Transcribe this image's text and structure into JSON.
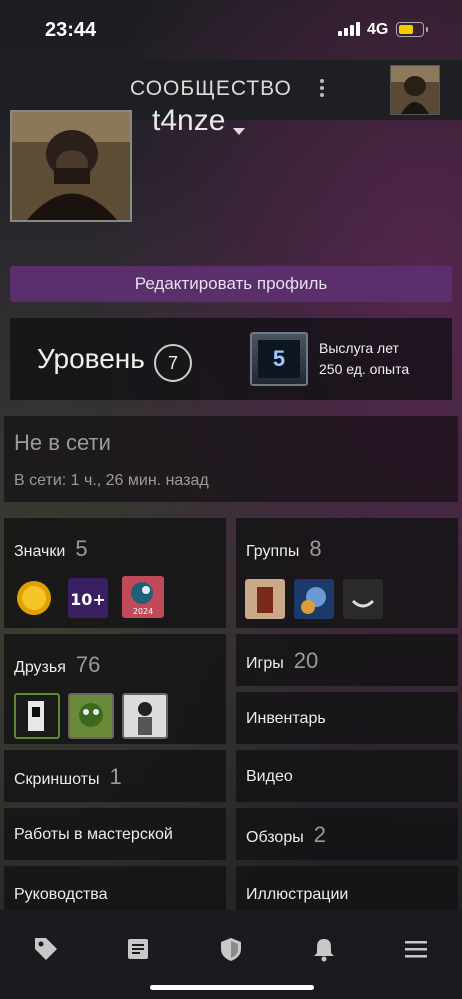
{
  "status_bar": {
    "time": "23:44",
    "network": "4G"
  },
  "header": {
    "title": "СООБЩЕСТВО"
  },
  "profile": {
    "username": "t4nze",
    "edit_label": "Редактировать профиль"
  },
  "level": {
    "label": "Уровень",
    "value": "7",
    "badge_value": "5",
    "service_title": "Выслуга лет",
    "service_xp": "250 ед. опыта"
  },
  "status": {
    "title": "Не в сети",
    "last_online": "В сети: 1 ч., 26 мин. назад"
  },
  "tiles": {
    "badges": {
      "label": "Значки",
      "count": "5",
      "icons": [
        "gold-coin-badge-icon",
        "10-plus-badge-icon",
        "steam-2024-badge-icon"
      ],
      "tenplus": "10+",
      "year": "2024"
    },
    "groups": {
      "label": "Группы",
      "count": "8"
    },
    "friends": {
      "label": "Друзья",
      "count": "76"
    },
    "games": {
      "label": "Игры",
      "count": "20"
    },
    "inventory": {
      "label": "Инвентарь"
    },
    "screenshots": {
      "label": "Скриншоты",
      "count": "1"
    },
    "videos": {
      "label": "Видео"
    },
    "workshop": {
      "label": "Работы в мастерской"
    },
    "reviews": {
      "label": "Обзоры",
      "count": "2"
    },
    "guides": {
      "label": "Руководства"
    },
    "artwork": {
      "label": "Иллюстрации"
    }
  },
  "bottom_nav": [
    "tag-icon",
    "news-icon",
    "shield-icon",
    "bell-icon",
    "menu-icon"
  ],
  "colors": {
    "accent": "#5a2f6b",
    "battery": "#f5cc00"
  }
}
